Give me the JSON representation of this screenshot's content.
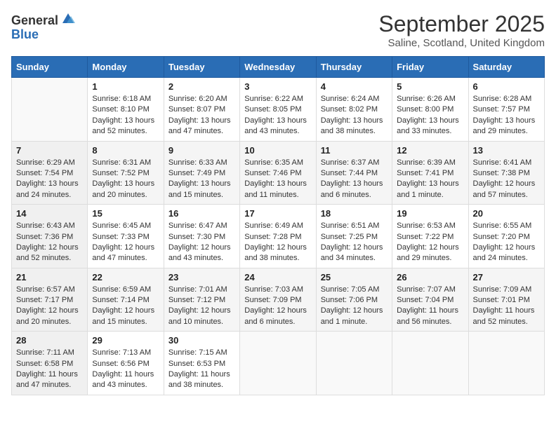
{
  "header": {
    "logo_general": "General",
    "logo_blue": "Blue",
    "month_title": "September 2025",
    "location": "Saline, Scotland, United Kingdom"
  },
  "weekdays": [
    "Sunday",
    "Monday",
    "Tuesday",
    "Wednesday",
    "Thursday",
    "Friday",
    "Saturday"
  ],
  "weeks": [
    [
      {
        "day": "",
        "sunrise": "",
        "sunset": "",
        "daylight": ""
      },
      {
        "day": "1",
        "sunrise": "Sunrise: 6:18 AM",
        "sunset": "Sunset: 8:10 PM",
        "daylight": "Daylight: 13 hours and 52 minutes."
      },
      {
        "day": "2",
        "sunrise": "Sunrise: 6:20 AM",
        "sunset": "Sunset: 8:07 PM",
        "daylight": "Daylight: 13 hours and 47 minutes."
      },
      {
        "day": "3",
        "sunrise": "Sunrise: 6:22 AM",
        "sunset": "Sunset: 8:05 PM",
        "daylight": "Daylight: 13 hours and 43 minutes."
      },
      {
        "day": "4",
        "sunrise": "Sunrise: 6:24 AM",
        "sunset": "Sunset: 8:02 PM",
        "daylight": "Daylight: 13 hours and 38 minutes."
      },
      {
        "day": "5",
        "sunrise": "Sunrise: 6:26 AM",
        "sunset": "Sunset: 8:00 PM",
        "daylight": "Daylight: 13 hours and 33 minutes."
      },
      {
        "day": "6",
        "sunrise": "Sunrise: 6:28 AM",
        "sunset": "Sunset: 7:57 PM",
        "daylight": "Daylight: 13 hours and 29 minutes."
      }
    ],
    [
      {
        "day": "7",
        "sunrise": "Sunrise: 6:29 AM",
        "sunset": "Sunset: 7:54 PM",
        "daylight": "Daylight: 13 hours and 24 minutes."
      },
      {
        "day": "8",
        "sunrise": "Sunrise: 6:31 AM",
        "sunset": "Sunset: 7:52 PM",
        "daylight": "Daylight: 13 hours and 20 minutes."
      },
      {
        "day": "9",
        "sunrise": "Sunrise: 6:33 AM",
        "sunset": "Sunset: 7:49 PM",
        "daylight": "Daylight: 13 hours and 15 minutes."
      },
      {
        "day": "10",
        "sunrise": "Sunrise: 6:35 AM",
        "sunset": "Sunset: 7:46 PM",
        "daylight": "Daylight: 13 hours and 11 minutes."
      },
      {
        "day": "11",
        "sunrise": "Sunrise: 6:37 AM",
        "sunset": "Sunset: 7:44 PM",
        "daylight": "Daylight: 13 hours and 6 minutes."
      },
      {
        "day": "12",
        "sunrise": "Sunrise: 6:39 AM",
        "sunset": "Sunset: 7:41 PM",
        "daylight": "Daylight: 13 hours and 1 minute."
      },
      {
        "day": "13",
        "sunrise": "Sunrise: 6:41 AM",
        "sunset": "Sunset: 7:38 PM",
        "daylight": "Daylight: 12 hours and 57 minutes."
      }
    ],
    [
      {
        "day": "14",
        "sunrise": "Sunrise: 6:43 AM",
        "sunset": "Sunset: 7:36 PM",
        "daylight": "Daylight: 12 hours and 52 minutes."
      },
      {
        "day": "15",
        "sunrise": "Sunrise: 6:45 AM",
        "sunset": "Sunset: 7:33 PM",
        "daylight": "Daylight: 12 hours and 47 minutes."
      },
      {
        "day": "16",
        "sunrise": "Sunrise: 6:47 AM",
        "sunset": "Sunset: 7:30 PM",
        "daylight": "Daylight: 12 hours and 43 minutes."
      },
      {
        "day": "17",
        "sunrise": "Sunrise: 6:49 AM",
        "sunset": "Sunset: 7:28 PM",
        "daylight": "Daylight: 12 hours and 38 minutes."
      },
      {
        "day": "18",
        "sunrise": "Sunrise: 6:51 AM",
        "sunset": "Sunset: 7:25 PM",
        "daylight": "Daylight: 12 hours and 34 minutes."
      },
      {
        "day": "19",
        "sunrise": "Sunrise: 6:53 AM",
        "sunset": "Sunset: 7:22 PM",
        "daylight": "Daylight: 12 hours and 29 minutes."
      },
      {
        "day": "20",
        "sunrise": "Sunrise: 6:55 AM",
        "sunset": "Sunset: 7:20 PM",
        "daylight": "Daylight: 12 hours and 24 minutes."
      }
    ],
    [
      {
        "day": "21",
        "sunrise": "Sunrise: 6:57 AM",
        "sunset": "Sunset: 7:17 PM",
        "daylight": "Daylight: 12 hours and 20 minutes."
      },
      {
        "day": "22",
        "sunrise": "Sunrise: 6:59 AM",
        "sunset": "Sunset: 7:14 PM",
        "daylight": "Daylight: 12 hours and 15 minutes."
      },
      {
        "day": "23",
        "sunrise": "Sunrise: 7:01 AM",
        "sunset": "Sunset: 7:12 PM",
        "daylight": "Daylight: 12 hours and 10 minutes."
      },
      {
        "day": "24",
        "sunrise": "Sunrise: 7:03 AM",
        "sunset": "Sunset: 7:09 PM",
        "daylight": "Daylight: 12 hours and 6 minutes."
      },
      {
        "day": "25",
        "sunrise": "Sunrise: 7:05 AM",
        "sunset": "Sunset: 7:06 PM",
        "daylight": "Daylight: 12 hours and 1 minute."
      },
      {
        "day": "26",
        "sunrise": "Sunrise: 7:07 AM",
        "sunset": "Sunset: 7:04 PM",
        "daylight": "Daylight: 11 hours and 56 minutes."
      },
      {
        "day": "27",
        "sunrise": "Sunrise: 7:09 AM",
        "sunset": "Sunset: 7:01 PM",
        "daylight": "Daylight: 11 hours and 52 minutes."
      }
    ],
    [
      {
        "day": "28",
        "sunrise": "Sunrise: 7:11 AM",
        "sunset": "Sunset: 6:58 PM",
        "daylight": "Daylight: 11 hours and 47 minutes."
      },
      {
        "day": "29",
        "sunrise": "Sunrise: 7:13 AM",
        "sunset": "Sunset: 6:56 PM",
        "daylight": "Daylight: 11 hours and 43 minutes."
      },
      {
        "day": "30",
        "sunrise": "Sunrise: 7:15 AM",
        "sunset": "Sunset: 6:53 PM",
        "daylight": "Daylight: 11 hours and 38 minutes."
      },
      {
        "day": "",
        "sunrise": "",
        "sunset": "",
        "daylight": ""
      },
      {
        "day": "",
        "sunrise": "",
        "sunset": "",
        "daylight": ""
      },
      {
        "day": "",
        "sunrise": "",
        "sunset": "",
        "daylight": ""
      },
      {
        "day": "",
        "sunrise": "",
        "sunset": "",
        "daylight": ""
      }
    ]
  ]
}
